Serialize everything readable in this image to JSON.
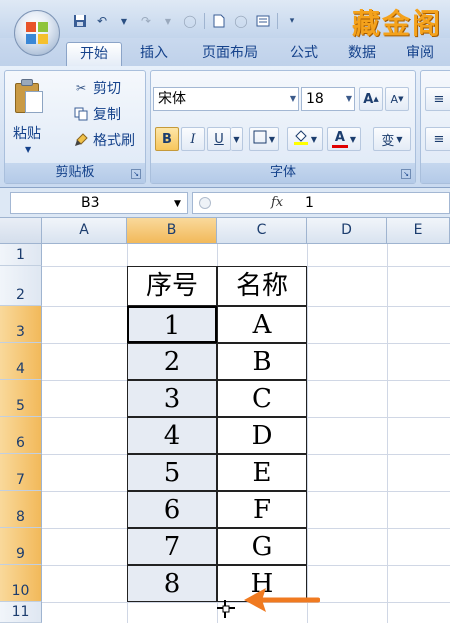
{
  "watermark": "藏金阁",
  "tabs": [
    {
      "label": "开始",
      "active": true
    },
    {
      "label": "插入",
      "active": false
    },
    {
      "label": "页面布局",
      "active": false
    },
    {
      "label": "公式",
      "active": false
    },
    {
      "label": "数据",
      "active": false
    },
    {
      "label": "审阅",
      "active": false
    }
  ],
  "clipboard": {
    "paste_label": "粘贴",
    "cut_label": "剪切",
    "copy_label": "复制",
    "format_painter_label": "格式刷",
    "group_label": "剪贴板"
  },
  "font": {
    "font_name": "宋体",
    "font_size": "18",
    "bold": "B",
    "italic": "I",
    "underline": "U",
    "font_color_glyph": "A",
    "phonetic": "变",
    "grow": "A",
    "shrink": "A",
    "group_label": "字体"
  },
  "formula_bar": {
    "cell_ref": "B3",
    "fx": "fx",
    "value": "1"
  },
  "columns": [
    "A",
    "B",
    "C",
    "D",
    "E"
  ],
  "rows": [
    "1",
    "2",
    "3",
    "4",
    "5",
    "6",
    "7",
    "8",
    "9",
    "10",
    "11"
  ],
  "table": {
    "headers": [
      "序号",
      "名称"
    ],
    "rows": [
      [
        "1",
        "A"
      ],
      [
        "2",
        "B"
      ],
      [
        "3",
        "C"
      ],
      [
        "4",
        "D"
      ],
      [
        "5",
        "E"
      ],
      [
        "6",
        "F"
      ],
      [
        "7",
        "G"
      ],
      [
        "8",
        "H"
      ]
    ]
  },
  "colors": {
    "selection_header": "#f2b95a",
    "arrow": "#f07a20",
    "watermark": "#f4a21c"
  }
}
